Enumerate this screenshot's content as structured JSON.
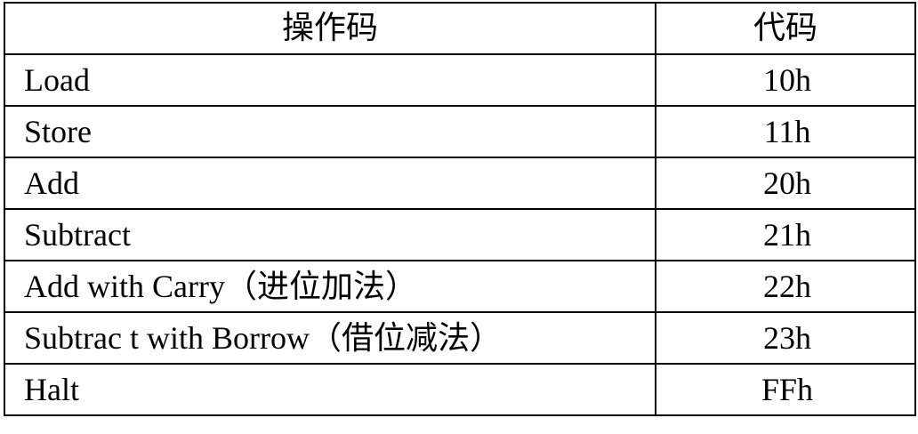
{
  "table": {
    "headers": {
      "operation": "操作码",
      "code": "代码"
    },
    "rows": [
      {
        "operation": "Load",
        "code": "10h"
      },
      {
        "operation": "Store",
        "code": "11h"
      },
      {
        "operation": "Add",
        "code": "20h"
      },
      {
        "operation": "Subtract",
        "code": "21h"
      },
      {
        "operation": "Add with Carry（进位加法）",
        "code": "22h"
      },
      {
        "operation": "Subtrac t with Borrow（借位减法）",
        "code": "23h"
      },
      {
        "operation": "Halt",
        "code": "FFh"
      }
    ]
  }
}
